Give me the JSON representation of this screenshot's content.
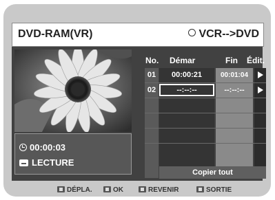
{
  "header": {
    "title": "DVD-RAM(VR)",
    "mode": "VCR-->DVD"
  },
  "info": {
    "time": "00:00:03",
    "status": "LECTURE"
  },
  "table": {
    "columns": [
      "No.",
      "Démar",
      "Fin",
      "Édit."
    ],
    "rows": [
      {
        "no": "01",
        "start": "00:00:21",
        "end": "00:01:04"
      },
      {
        "no": "02",
        "start": "--:--:--",
        "end": "--:--:--"
      }
    ],
    "copy_all": "Copier tout"
  },
  "footer": {
    "move": "DÉPLA.",
    "ok": "OK",
    "back": "REVENIR",
    "exit": "SORTIE"
  },
  "icons": [
    "clock-icon",
    "play-mode-icon",
    "arrow-right-icon",
    "move-icon",
    "ok-icon",
    "return-icon",
    "exit-icon"
  ]
}
